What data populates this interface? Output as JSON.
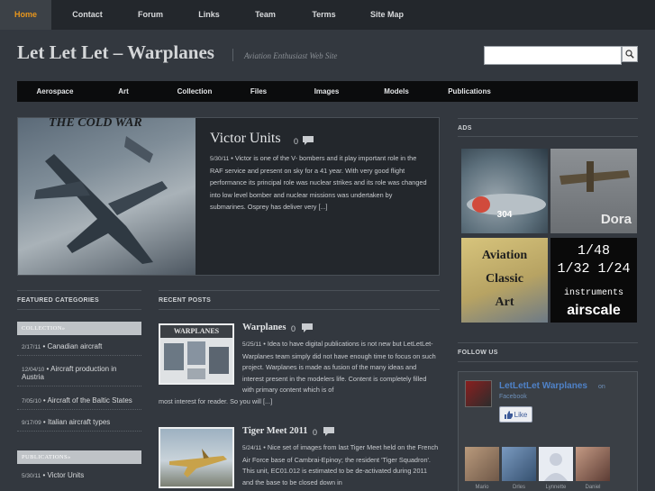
{
  "topnav": [
    "Home",
    "Contact",
    "Forum",
    "Links",
    "Team",
    "Terms",
    "Site Map"
  ],
  "site": {
    "title": "Let Let Let – Warplanes",
    "tagline": "Aviation Enthusiast Web Site"
  },
  "search": {
    "value": ""
  },
  "catbar": [
    "Aerospace",
    "Art",
    "Collection",
    "Files",
    "Images",
    "Models",
    "Publications"
  ],
  "featured": {
    "image_caption": "THE COLD WAR",
    "title": "Victor Units",
    "comments": "0",
    "date": "5/30/11",
    "text": "Victor is one of the V- bombers and it play important role in the RAF service and present on sky for a 41 year. With very good flight performance its principal role was nuclear strikes and its role was changed into low level bomber and nuclear missions was undertaken by submarines. Osprey has deliver very [...]"
  },
  "sidebar": {
    "ads_heading": "ADS",
    "ads": [
      {
        "lines": [
          "304"
        ]
      },
      {
        "lines": [
          "Dora"
        ]
      },
      {
        "lines": [
          "Aviation",
          "Classic",
          "Art"
        ]
      },
      {
        "lines": [
          "1/48",
          "1/32 1/24",
          "instruments",
          "airscale"
        ]
      }
    ],
    "follow_heading": "FOLLOW US",
    "facebook": {
      "name": "LetLetLet Warplanes",
      "on": "on",
      "site": "Facebook",
      "like": "Like",
      "avatars": [
        "Mario",
        "Drles",
        "Lynnette",
        "Daniel"
      ]
    }
  },
  "categories": {
    "heading": "FEATURED CATEGORIES",
    "groups": [
      {
        "label": "COLLECTION»",
        "items": [
          {
            "date": "2/17/11",
            "title": "Canadian aircraft"
          },
          {
            "date": "12/04/10",
            "title": "Aircraft production in Austria"
          },
          {
            "date": "7/05/10",
            "title": "Aircraft of the Baltic States"
          },
          {
            "date": "9/17/09",
            "title": "Italian aircraft types"
          }
        ]
      },
      {
        "label": "PUBLICATIONS»",
        "items": [
          {
            "date": "5/30/11",
            "title": "Victor Units"
          }
        ]
      }
    ]
  },
  "recent": {
    "heading": "RECENT POSTS",
    "posts": [
      {
        "thumb_caption": "WARPLANES",
        "title": "Warplanes",
        "comments": "0",
        "date": "5/25/11",
        "text_a": "Idea to have digital publications is not new but LetLetLet-Warplanes team simply did not have enough time to focus on such project. Warplanes is made as fusion of the many ideas and interest present in the modelers life. Content is completely filled with primary content which is of",
        "text_b": "most interest for reader. So you will [...]"
      },
      {
        "title": "Tiger Meet 2011",
        "comments": "0",
        "date": "5/24/11",
        "text_a": "Nice set of images from last Tiger Meet held on the French Air Force base of Cambrai-Epinoy; the resident 'Tiger Squadron'. This unit, EC01.012 is estimated to be de-activated during 2011 and the base to be closed down in"
      }
    ]
  }
}
